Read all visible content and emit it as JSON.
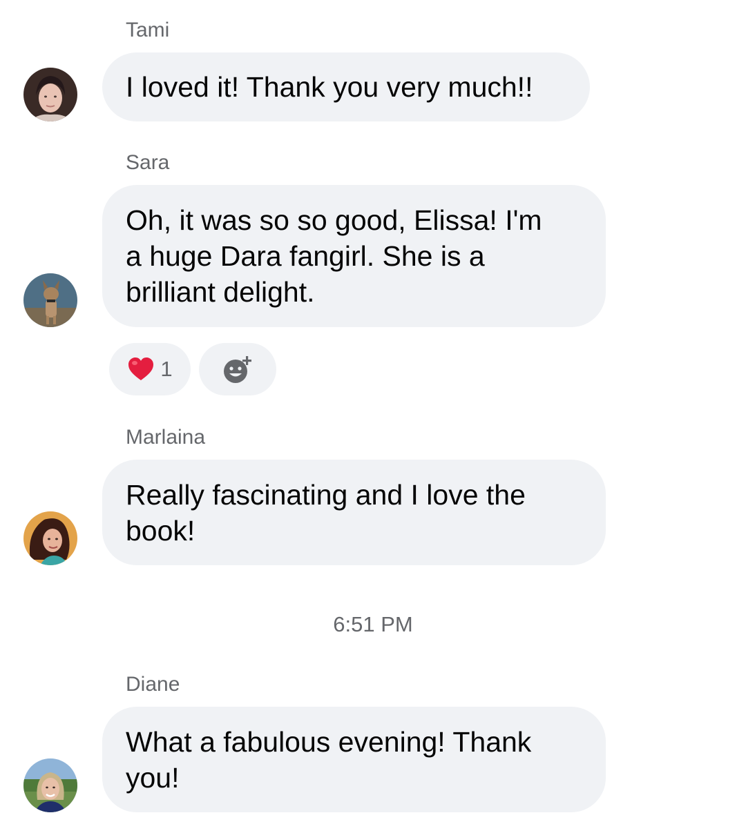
{
  "messages": [
    {
      "sender": "Tami",
      "text": "I loved it! Thank you very much!!",
      "avatar_icon": "avatar-tami"
    },
    {
      "sender": "Sara",
      "text": "Oh, it was so so good, Elissa! I'm\na huge Dara fangirl. She is a\nbrilliant delight.",
      "avatar_icon": "avatar-sara",
      "reactions": {
        "heart_icon": "heart-icon",
        "heart_count": "1",
        "add_reaction_icon": "add-reaction-icon"
      }
    },
    {
      "sender": "Marlaina",
      "text": "Really fascinating and I love the\nbook!",
      "avatar_icon": "avatar-marlaina"
    },
    {
      "sender": "Diane",
      "text": "What a fabulous evening! Thank\nyou!",
      "avatar_icon": "avatar-diane"
    }
  ],
  "timestamp": "6:51 PM",
  "colors": {
    "bubble": "#f0f2f5",
    "secondary_text": "#65676b",
    "heart": "#e41e3f"
  }
}
